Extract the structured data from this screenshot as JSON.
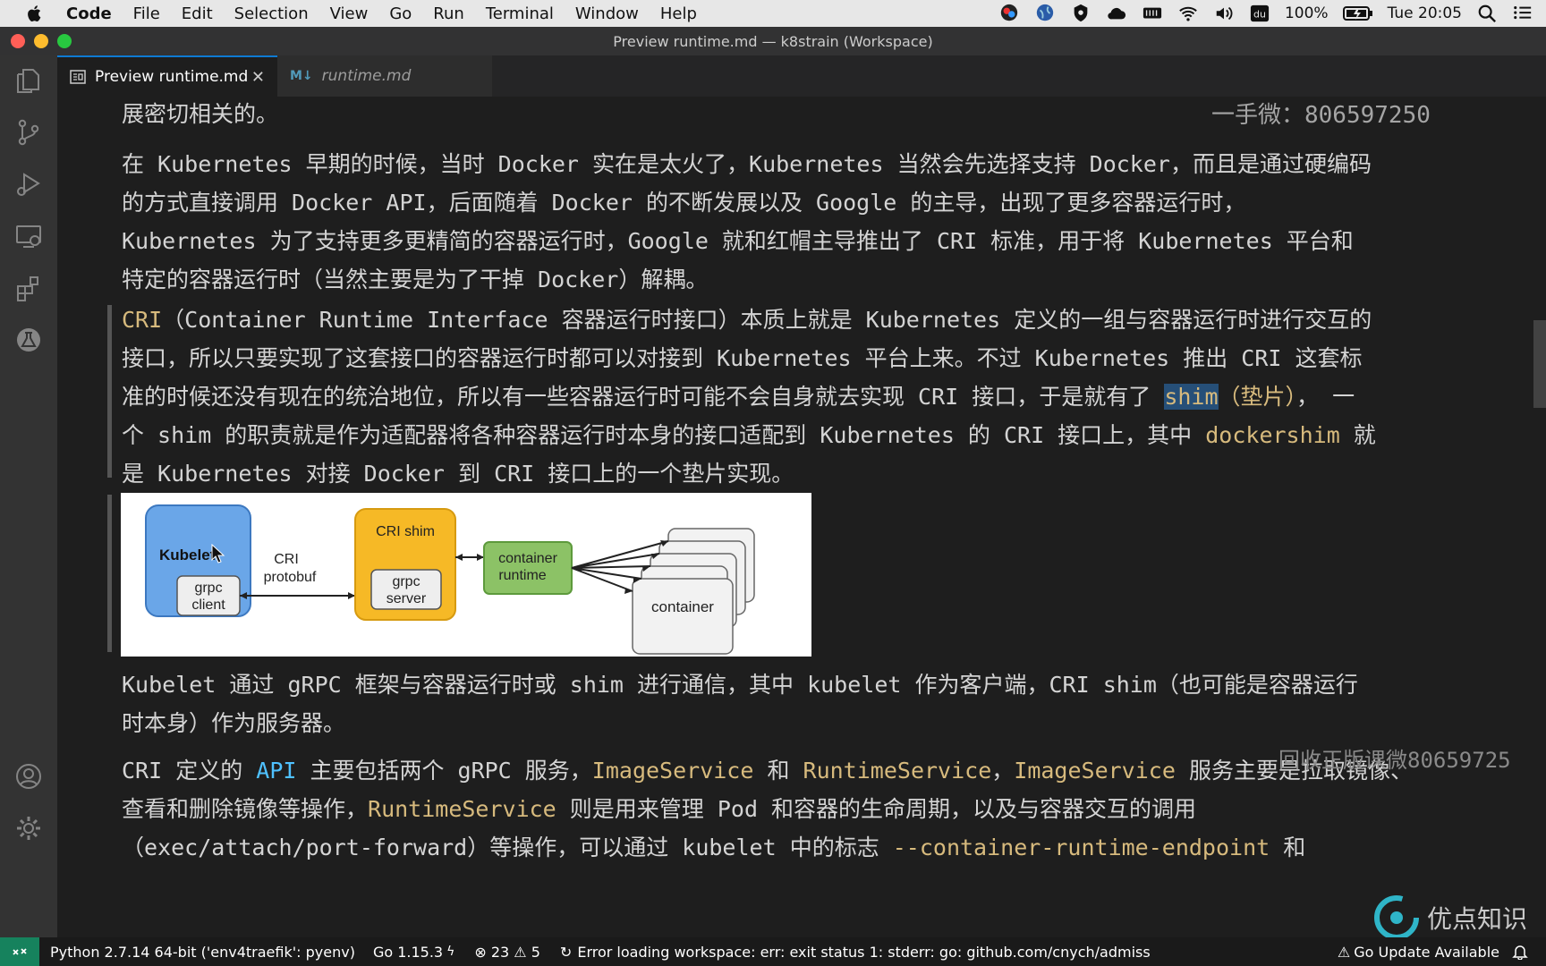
{
  "menubar": {
    "app": "Code",
    "items": [
      "File",
      "Edit",
      "Selection",
      "View",
      "Go",
      "Run",
      "Terminal",
      "Window",
      "Help"
    ],
    "battery": "100%",
    "clock": "Tue 20:05"
  },
  "window": {
    "title": "Preview runtime.md — k8strain (Workspace)"
  },
  "tabs": [
    {
      "label": "Preview runtime.md",
      "icon": "preview-icon",
      "active": true
    },
    {
      "label": "runtime.md",
      "icon": "markdown-icon",
      "active": false
    }
  ],
  "tab_badge": "M↓",
  "watermarks": {
    "top": "一手微：806597250",
    "bottom": "回收正版课微80659725",
    "brand": "优点知识"
  },
  "content": {
    "p0": "展密切相关的。",
    "p1": [
      "在 Kubernetes 早期的时候，当时 Docker 实在是太火了，Kubernetes 当然会先选择支持 Docker，而且是通过硬编码",
      "的方式直接调用 Docker API，后面随着 Docker 的不断发展以及 Google 的主导，出现了更多容器运行时，",
      "Kubernetes 为了支持更多更精简的容器运行时，Google 就和红帽主导推出了 CRI 标准，用于将 Kubernetes 平台和",
      "特定的容器运行时（当然主要是为了干掉 Docker）解耦。"
    ],
    "quote": {
      "l1_a": "CRI",
      "l1_b": "（Container Runtime Interface 容器运行时接口）本质上就是 Kubernetes 定义的一组与容器运行时进行交互的",
      "l2": "接口，所以只要实现了这套接口的容器运行时都可以对接到 Kubernetes 平台上来。不过 Kubernetes 推出 CRI 这套标",
      "l3_a": "准的时候还没有现在的统治地位，所以有一些容器运行时可能不会自身就去实现 CRI 接口，于是就有了 ",
      "l3_sel": "shim",
      "l3_b": "（垫片）",
      "l3_c": "， 一",
      "l4_a": "个 shim 的职责就是作为适配器将各种容器运行时本身的接口适配到 Kubernetes 的 CRI 接口上，其中 ",
      "l4_hl": "dockershim",
      "l4_b": " 就",
      "l5": "是 Kubernetes 对接 Docker 到 CRI 接口上的一个垫片实现。"
    },
    "diagram": {
      "kubelet": "Kubelet",
      "grpc_client_1": "grpc",
      "grpc_client_2": "client",
      "cri_1": "CRI",
      "cri_2": "protobuf",
      "cri_shim": "CRI shim",
      "grpc_server_1": "grpc",
      "grpc_server_2": "server",
      "runtime_1": "container",
      "runtime_2": "runtime",
      "container": "container"
    },
    "p2": [
      "Kubelet 通过 gRPC 框架与容器运行时或 shim 进行通信，其中 kubelet 作为客户端，CRI shim（也可能是容器运行",
      "时本身）作为服务器。"
    ],
    "p3": {
      "a": "CRI 定义的 ",
      "api": "API",
      "b": " 主要包括两个 gRPC 服务，",
      "img1": "ImageService",
      "c": " 和 ",
      "rt1": "RuntimeService",
      "d": "，",
      "img2": "ImageService",
      "e": " 服务主要是拉取镜像、",
      "l2_a": "查看和删除镜像等操作，",
      "rt2": "RuntimeService",
      "l2_b": " 则是用来管理 Pod 和容器的生命周期，以及与容器交互的调用",
      "l3_a": "（exec/attach/port-forward）等操作，可以通过 kubelet 中的标志 ",
      "flag": "--container-runtime-endpoint",
      "l3_b": " 和"
    }
  },
  "statusbar": {
    "python": "Python 2.7.14 64-bit ('env4traefik': pyenv)",
    "go": "Go 1.15.3",
    "errors": "23",
    "warnings": "5",
    "message": "Error loading workspace: err: exit status 1: stderr: go: github.com/cnych/admission-we",
    "update": "Go Update Available"
  },
  "colors": {
    "accent": "#0e7ad3",
    "remote": "#16825d",
    "highlight": "#d7ba7d",
    "link": "#4fc1ff"
  }
}
